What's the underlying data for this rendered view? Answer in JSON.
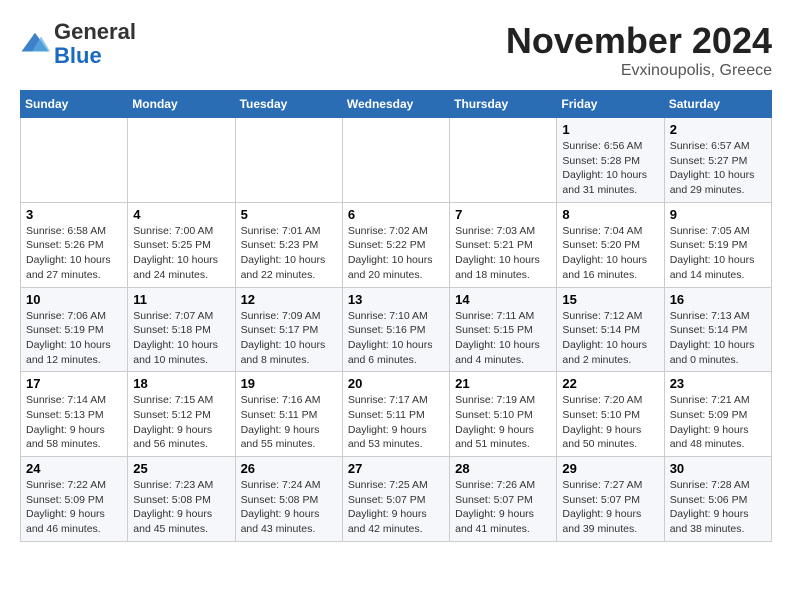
{
  "header": {
    "logo_line1": "General",
    "logo_line2": "Blue",
    "month": "November 2024",
    "location": "Evxinoupolis, Greece"
  },
  "days_of_week": [
    "Sunday",
    "Monday",
    "Tuesday",
    "Wednesday",
    "Thursday",
    "Friday",
    "Saturday"
  ],
  "weeks": [
    [
      {
        "day": "",
        "info": ""
      },
      {
        "day": "",
        "info": ""
      },
      {
        "day": "",
        "info": ""
      },
      {
        "day": "",
        "info": ""
      },
      {
        "day": "",
        "info": ""
      },
      {
        "day": "1",
        "info": "Sunrise: 6:56 AM\nSunset: 5:28 PM\nDaylight: 10 hours and 31 minutes."
      },
      {
        "day": "2",
        "info": "Sunrise: 6:57 AM\nSunset: 5:27 PM\nDaylight: 10 hours and 29 minutes."
      }
    ],
    [
      {
        "day": "3",
        "info": "Sunrise: 6:58 AM\nSunset: 5:26 PM\nDaylight: 10 hours and 27 minutes."
      },
      {
        "day": "4",
        "info": "Sunrise: 7:00 AM\nSunset: 5:25 PM\nDaylight: 10 hours and 24 minutes."
      },
      {
        "day": "5",
        "info": "Sunrise: 7:01 AM\nSunset: 5:23 PM\nDaylight: 10 hours and 22 minutes."
      },
      {
        "day": "6",
        "info": "Sunrise: 7:02 AM\nSunset: 5:22 PM\nDaylight: 10 hours and 20 minutes."
      },
      {
        "day": "7",
        "info": "Sunrise: 7:03 AM\nSunset: 5:21 PM\nDaylight: 10 hours and 18 minutes."
      },
      {
        "day": "8",
        "info": "Sunrise: 7:04 AM\nSunset: 5:20 PM\nDaylight: 10 hours and 16 minutes."
      },
      {
        "day": "9",
        "info": "Sunrise: 7:05 AM\nSunset: 5:19 PM\nDaylight: 10 hours and 14 minutes."
      }
    ],
    [
      {
        "day": "10",
        "info": "Sunrise: 7:06 AM\nSunset: 5:19 PM\nDaylight: 10 hours and 12 minutes."
      },
      {
        "day": "11",
        "info": "Sunrise: 7:07 AM\nSunset: 5:18 PM\nDaylight: 10 hours and 10 minutes."
      },
      {
        "day": "12",
        "info": "Sunrise: 7:09 AM\nSunset: 5:17 PM\nDaylight: 10 hours and 8 minutes."
      },
      {
        "day": "13",
        "info": "Sunrise: 7:10 AM\nSunset: 5:16 PM\nDaylight: 10 hours and 6 minutes."
      },
      {
        "day": "14",
        "info": "Sunrise: 7:11 AM\nSunset: 5:15 PM\nDaylight: 10 hours and 4 minutes."
      },
      {
        "day": "15",
        "info": "Sunrise: 7:12 AM\nSunset: 5:14 PM\nDaylight: 10 hours and 2 minutes."
      },
      {
        "day": "16",
        "info": "Sunrise: 7:13 AM\nSunset: 5:14 PM\nDaylight: 10 hours and 0 minutes."
      }
    ],
    [
      {
        "day": "17",
        "info": "Sunrise: 7:14 AM\nSunset: 5:13 PM\nDaylight: 9 hours and 58 minutes."
      },
      {
        "day": "18",
        "info": "Sunrise: 7:15 AM\nSunset: 5:12 PM\nDaylight: 9 hours and 56 minutes."
      },
      {
        "day": "19",
        "info": "Sunrise: 7:16 AM\nSunset: 5:11 PM\nDaylight: 9 hours and 55 minutes."
      },
      {
        "day": "20",
        "info": "Sunrise: 7:17 AM\nSunset: 5:11 PM\nDaylight: 9 hours and 53 minutes."
      },
      {
        "day": "21",
        "info": "Sunrise: 7:19 AM\nSunset: 5:10 PM\nDaylight: 9 hours and 51 minutes."
      },
      {
        "day": "22",
        "info": "Sunrise: 7:20 AM\nSunset: 5:10 PM\nDaylight: 9 hours and 50 minutes."
      },
      {
        "day": "23",
        "info": "Sunrise: 7:21 AM\nSunset: 5:09 PM\nDaylight: 9 hours and 48 minutes."
      }
    ],
    [
      {
        "day": "24",
        "info": "Sunrise: 7:22 AM\nSunset: 5:09 PM\nDaylight: 9 hours and 46 minutes."
      },
      {
        "day": "25",
        "info": "Sunrise: 7:23 AM\nSunset: 5:08 PM\nDaylight: 9 hours and 45 minutes."
      },
      {
        "day": "26",
        "info": "Sunrise: 7:24 AM\nSunset: 5:08 PM\nDaylight: 9 hours and 43 minutes."
      },
      {
        "day": "27",
        "info": "Sunrise: 7:25 AM\nSunset: 5:07 PM\nDaylight: 9 hours and 42 minutes."
      },
      {
        "day": "28",
        "info": "Sunrise: 7:26 AM\nSunset: 5:07 PM\nDaylight: 9 hours and 41 minutes."
      },
      {
        "day": "29",
        "info": "Sunrise: 7:27 AM\nSunset: 5:07 PM\nDaylight: 9 hours and 39 minutes."
      },
      {
        "day": "30",
        "info": "Sunrise: 7:28 AM\nSunset: 5:06 PM\nDaylight: 9 hours and 38 minutes."
      }
    ]
  ]
}
